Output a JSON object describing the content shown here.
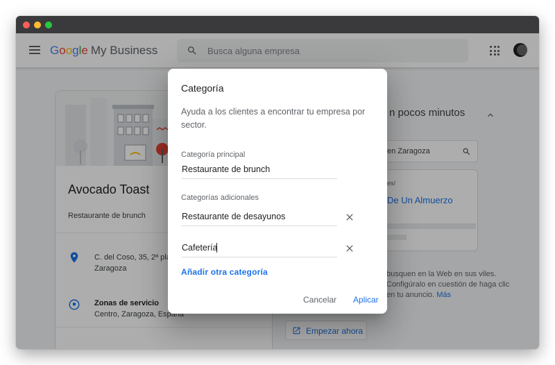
{
  "header": {
    "brand_google": [
      "G",
      "o",
      "o",
      "g",
      "l",
      "e"
    ],
    "brand_suffix": "My Business",
    "search_placeholder": "Busca alguna empresa",
    "icons": {
      "menu": "menu-icon",
      "search": "search-icon",
      "apps": "apps-grid-icon",
      "account": "avatar"
    }
  },
  "business_card": {
    "name": "Avocado Toast",
    "category": "Restaurante de brunch",
    "address_line1": "C. del Coso, 35, 2ª plan",
    "address_line2": "Zaragoza",
    "service_area_title": "Zonas de servicio",
    "service_area_value": "Centro, Zaragoza, España"
  },
  "right_panel": {
    "title_fragment": "n pocos minutos",
    "search_fragment": "en Zaragoza",
    "url_fragment": "es/",
    "link_fragment": "De Un Almuerzo",
    "desc_fragment": "busquen en la Web en sus viles. Configúralo en cuestión de haga clic en tu anuncio.",
    "desc_more": "Más",
    "cta_label": "Empezar ahora"
  },
  "dialog": {
    "title": "Categoría",
    "help": "Ayuda a los clientes a encontrar tu empresa por sector.",
    "primary_label": "Categoría principal",
    "primary_value": "Restaurante de brunch",
    "additional_label": "Categorías adicionales",
    "additional": [
      {
        "value": "Restaurante de desayunos"
      },
      {
        "value": "Cafetería"
      }
    ],
    "add_link": "Añadir otra categoría",
    "cancel": "Cancelar",
    "apply": "Aplicar"
  },
  "colors": {
    "accent": "#1a73e8",
    "scrim": "rgba(0,0,0,0.32)",
    "titlebar": "#3a3a3c"
  }
}
